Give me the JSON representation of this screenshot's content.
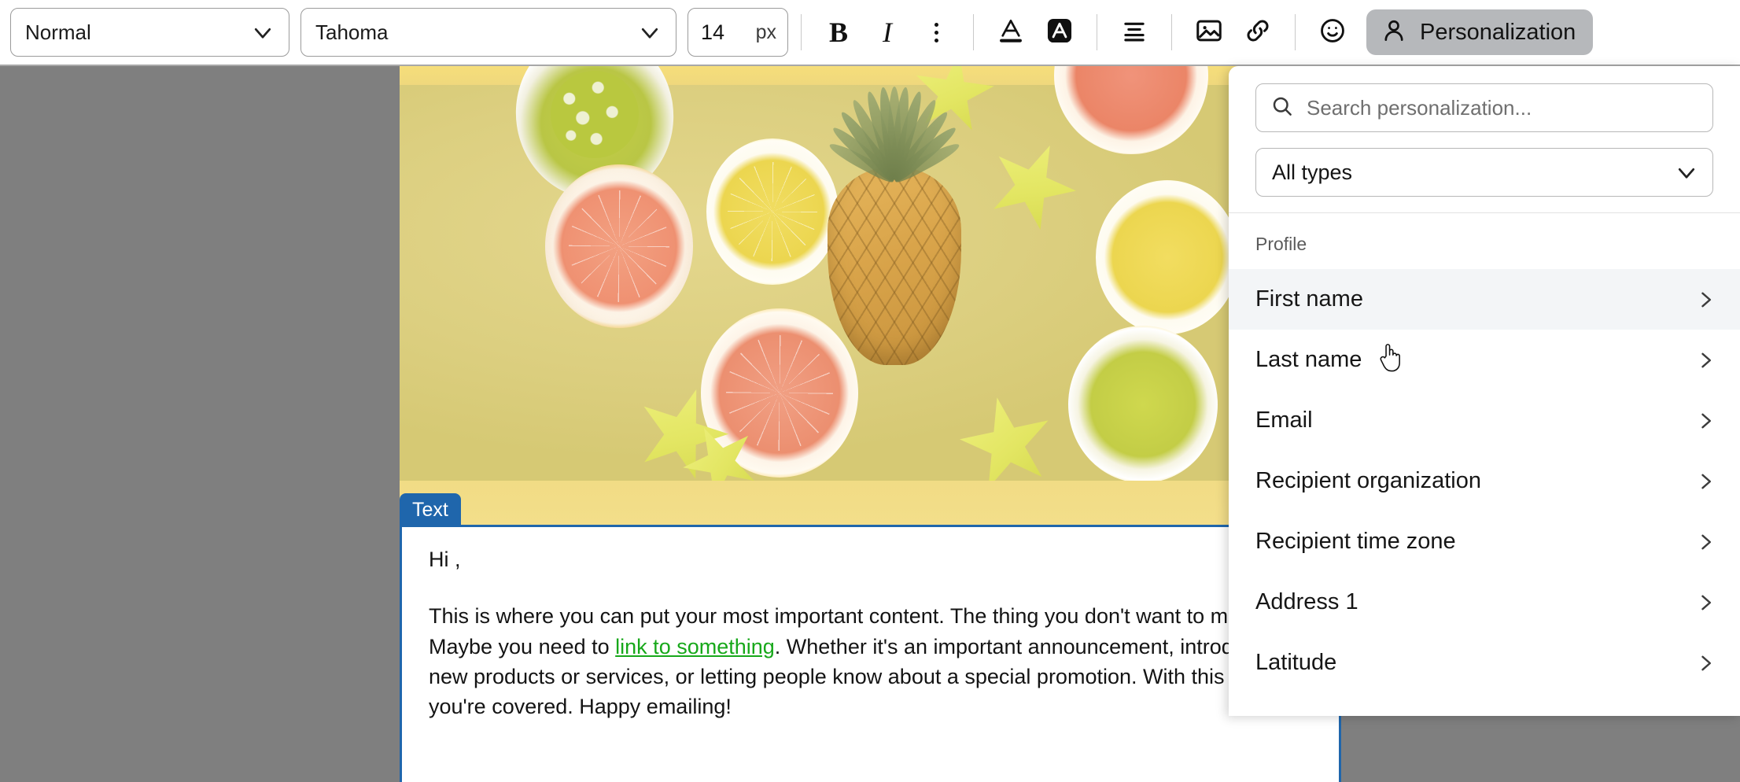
{
  "toolbar": {
    "style_select": {
      "value": "Normal",
      "icon": "chevron-down-icon"
    },
    "font_select": {
      "value": "Tahoma",
      "icon": "chevron-down-icon"
    },
    "font_size": {
      "value": "14",
      "unit": "px"
    },
    "bold_label": "B",
    "italic_label": "I",
    "more_label": "more-options",
    "buttons": [
      {
        "name": "text-color-button",
        "icon": "text-color-icon"
      },
      {
        "name": "highlight-color-button",
        "icon": "highlight-icon"
      },
      {
        "name": "align-button",
        "icon": "align-center-icon"
      },
      {
        "name": "image-button",
        "icon": "image-icon"
      },
      {
        "name": "link-button",
        "icon": "link-icon"
      },
      {
        "name": "emoji-button",
        "icon": "emoji-icon"
      }
    ],
    "personalization": {
      "label": "Personalization",
      "icon": "person-icon",
      "active": true
    }
  },
  "canvas": {
    "block_tag": "Text",
    "greeting": "Hi ,",
    "paragraph_parts": {
      "before_link": "This is where you can put your most important content. The thing you don't want to miss. Maybe you need to ",
      "link_text": "link to something",
      "after_link": ". Whether it's an important announcement, introducing new products or services, or letting people know about a special promotion. With this section, you're covered. Happy emailing!"
    },
    "link_color": "#17a81a",
    "block_border_color": "#1f66ac"
  },
  "panel": {
    "search": {
      "placeholder": "Search personalization...",
      "value": "",
      "icon": "search-icon"
    },
    "type_filter": {
      "value": "All types",
      "icon": "chevron-down-icon"
    },
    "group_label": "Profile",
    "items": [
      {
        "label": "First name",
        "hovered": true
      },
      {
        "label": "Last name",
        "hovered": false
      },
      {
        "label": "Email",
        "hovered": false
      },
      {
        "label": "Recipient organization",
        "hovered": false
      },
      {
        "label": "Recipient time zone",
        "hovered": false
      },
      {
        "label": "Address 1",
        "hovered": false
      },
      {
        "label": "Latitude",
        "hovered": false
      }
    ],
    "item_arrow_icon": "chevron-right-icon"
  },
  "colors": {
    "accent_blue": "#1f66ac",
    "link_green": "#17a81a",
    "active_grey": "#b6b8bb",
    "backdrop": "rgba(0,0,0,0.5)"
  }
}
